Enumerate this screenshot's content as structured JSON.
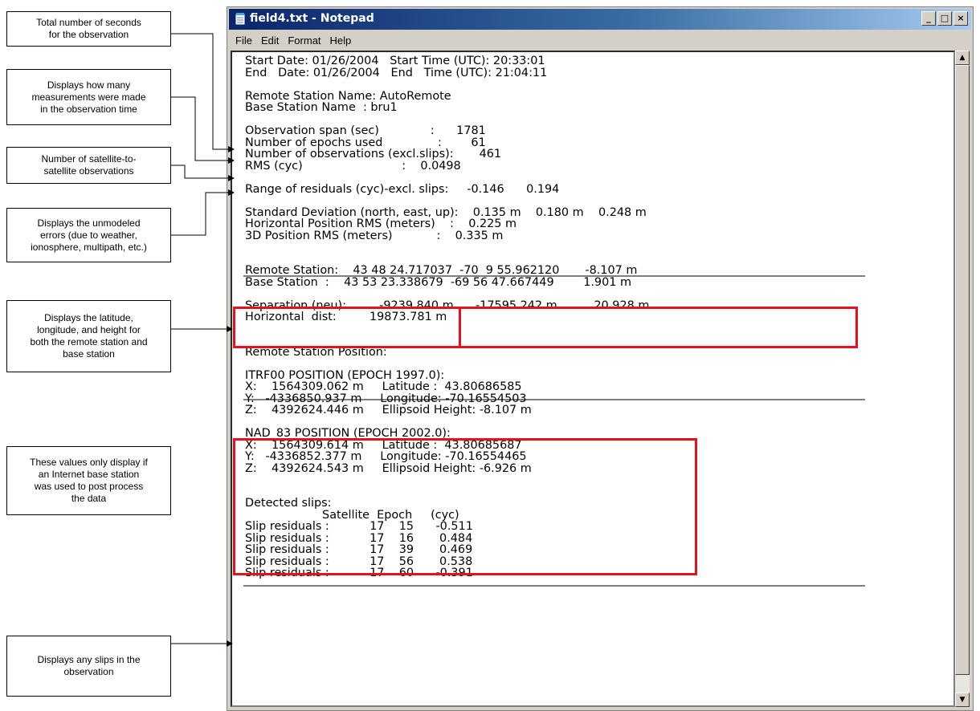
{
  "window": {
    "title": "field4.txt - Notepad",
    "controls": [
      "_",
      "□",
      "×"
    ],
    "icon": "notepad-icon"
  },
  "menu": [
    "File",
    "Edit",
    "Format",
    "Help"
  ],
  "document_lines": [
    "Start Date: 01/26/2004   Start Time (UTC): 20:33:01",
    "End   Date: 01/26/2004   End   Time (UTC): 21:04:11",
    "",
    "Remote Station Name: AutoRemote",
    "Base Station Name  : bru1",
    "",
    "Observation span (sec)              :      1781",
    "Number of epochs used               :        61",
    "Number of observations (excl.slips):       461",
    "RMS (cyc)                           :    0.0498",
    "",
    "Range of residuals (cyc)-excl. slips:     -0.146      0.194",
    "",
    "Standard Deviation (north, east, up):    0.135 m    0.180 m    0.248 m",
    "Horizontal Position RMS (meters)    :    0.225 m",
    "3D Position RMS (meters)            :    0.335 m",
    "",
    "",
    "Remote Station:    43 48 24.717037  -70  9 55.962120       -8.107 m",
    "Base Station  :    43 53 23.338679  -69 56 47.667449        1.901 m",
    "",
    "Separation (neu):         -9239.840 m      -17595.242 m          20.928 m",
    "Horizontal  dist:         19873.781 m",
    "",
    "",
    "Remote Station Position:",
    "",
    "ITRF00 POSITION (EPOCH 1997.0):",
    "X:    1564309.062 m     Latitude :  43.80686585",
    "Y:   -4336850.937 m     Longitude: -70.16554503",
    "Z:    4392624.446 m     Ellipsoid Height: -8.107 m",
    "",
    "NAD_83 POSITION (EPOCH 2002.0):",
    "X:    1564309.614 m     Latitude :  43.80685687",
    "Y:   -4336852.377 m     Longitude: -70.16554465",
    "Z:    4392624.543 m     Ellipsoid Height: -6.926 m",
    "",
    "",
    "Detected slips:",
    "                     Satellite  Epoch     (cyc)",
    "Slip residuals :           17    15      -0.511",
    "Slip residuals :           17    16       0.484",
    "Slip residuals :           17    39       0.469",
    "Slip residuals :           17    56       0.538",
    "Slip residuals :           17    60      -0.391"
  ],
  "callouts": [
    "Total number of seconds\nfor the observation",
    "Displays how many\nmeasurements were made\nin the observation time",
    "Number of satellite-to-\nsatellite observations",
    "Displays the unmodeled\nerrors (due to weather,\nionosphere, multipath, etc.)",
    "Displays the latitude,\nlongitude, and height for\nboth the remote station and\nbase station",
    "These values only display if\nan Internet base station\nwas used to post process\nthe data",
    "Displays any slips in the\nobservation"
  ],
  "colors": {
    "highlight": "#e8111a",
    "titlebar": "#0a246a"
  }
}
